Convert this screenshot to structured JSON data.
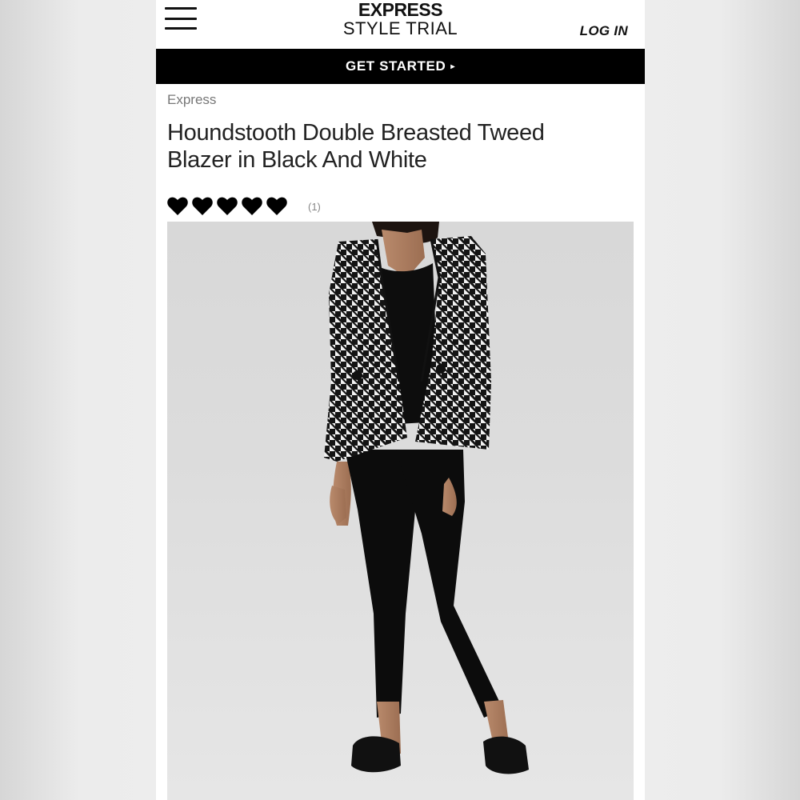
{
  "header": {
    "brand": "EXPRESS",
    "subtitle": "STYLE TRIAL",
    "login_label": "LOG IN"
  },
  "cta": {
    "label": "GET STARTED",
    "arrow": "▸"
  },
  "product": {
    "vendor": "Express",
    "title_line1": "Houndstooth Double Breasted Tweed",
    "title_line2": "Blazer in Black And White",
    "rating_value": 5,
    "rating_max": 5,
    "review_count": "(1)",
    "image_icon": "model-photo"
  },
  "colors": {
    "cta_background": "#000000",
    "heart": "#000000",
    "text": "#222222",
    "muted": "#777777"
  }
}
